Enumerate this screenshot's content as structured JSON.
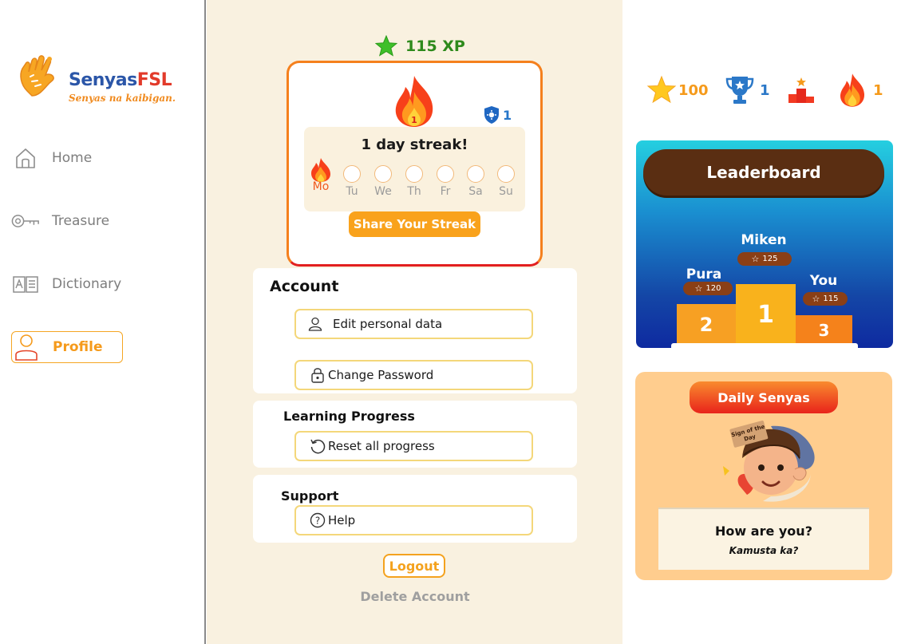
{
  "brand": {
    "name_part1": "Senyas",
    "name_part2": "FSL",
    "tagline": "Senyas na kaibigan."
  },
  "nav": {
    "items": [
      {
        "label": "Home",
        "icon": "home-icon"
      },
      {
        "label": "Treasure",
        "icon": "key-icon"
      },
      {
        "label": "Dictionary",
        "icon": "dictionary-icon"
      },
      {
        "label": "Profile",
        "icon": "user-icon",
        "active": true
      }
    ]
  },
  "xp": {
    "label": "115 XP"
  },
  "streak": {
    "shield_count": "1",
    "title": "1 day streak!",
    "days": [
      "Mo",
      "Tu",
      "We",
      "Th",
      "Fr",
      "Sa",
      "Su"
    ],
    "completed_days": [
      "Mo"
    ],
    "share_label": "Share Your Streak"
  },
  "account": {
    "title": "Account",
    "edit_label": "Edit personal data",
    "password_label": "Change Password"
  },
  "learning": {
    "title": "Learning Progress",
    "reset_label": "Reset all progress"
  },
  "support": {
    "title": "Support",
    "help_label": "Help"
  },
  "logout_label": "Logout",
  "delete_label": "Delete Account",
  "stats": {
    "stars": "100",
    "trophies": "1",
    "rank": "",
    "fire": "1"
  },
  "leaderboard": {
    "title": "Leaderboard",
    "players": [
      {
        "name": "Miken",
        "score": "125",
        "place": "1"
      },
      {
        "name": "Pura",
        "score": "120",
        "place": "2"
      },
      {
        "name": "You",
        "score": "115",
        "place": "3"
      }
    ]
  },
  "daily": {
    "title": "Daily Senyas",
    "badge": "Sign of the Day",
    "question": "How are you?",
    "answer": "Kamusta ka?"
  },
  "colors": {
    "accent": "#f59a1b",
    "green": "#2e8a1c",
    "panel_bg": "#f9f1e0"
  }
}
